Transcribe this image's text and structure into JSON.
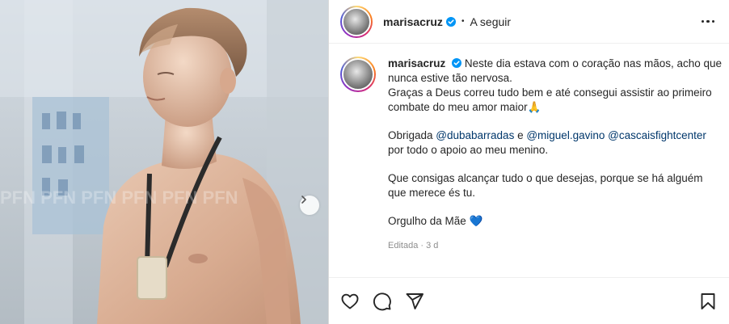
{
  "header": {
    "username": "marisacruz",
    "separator": "•",
    "follow_label": "A seguir"
  },
  "caption": {
    "username": "marisacruz",
    "line1": "Neste dia estava com o coração nas mãos, acho que nunca estive tão nervosa.",
    "line2": "Graças a Deus correu tudo bem e até consegui assistir ao primeiro combate do meu amor maior",
    "line2_emoji": "🙏",
    "thanks_prefix": "Obrigada ",
    "mention1": "@dubabarradas",
    "and_word": " e ",
    "mention2": "@miguel.gavino",
    "mention3": "@cascaisfightcenter",
    "thanks_suffix": "por todo o apoio ao meu menino.",
    "wish": "Que consigas alcançar tudo o que desejas, porque se há alguém que merece és tu.",
    "pride": "Orgulho da Mãe",
    "pride_emoji": "💙",
    "edited": "Editada",
    "meta_sep": "·",
    "time": "3 d"
  },
  "photo": {
    "watermark": "PFN PFN PFN PFN PFN PFN"
  },
  "icons": {
    "like": "heart-icon",
    "comment": "comment-icon",
    "share": "paper-plane-icon",
    "save": "bookmark-icon",
    "next": "chevron-right-icon",
    "verified": "verified-badge-icon",
    "more": "more-options-icon"
  },
  "colors": {
    "verified": "#0095f6",
    "mention": "#00376b",
    "muted": "#8e8e8e"
  }
}
